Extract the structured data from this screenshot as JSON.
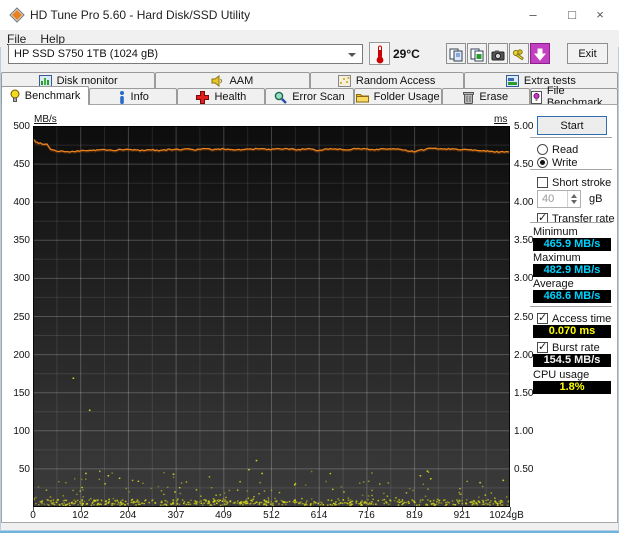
{
  "window": {
    "title": "HD Tune Pro 5.60 - Hard Disk/SSD Utility",
    "menu": [
      "File",
      "Help"
    ],
    "minimize_glyph": "–",
    "maximize_glyph": "□",
    "close_glyph": "×"
  },
  "toolbar": {
    "drive_selected": "HP SSD S750 1TB (1024 gB)",
    "temperature": "29°C",
    "exit_label": "Exit",
    "buttons": [
      "copy-text-icon",
      "copy-image-icon",
      "screenshot-icon",
      "settings-keys-icon",
      "save-results-icon"
    ]
  },
  "tabs_row1": [
    {
      "label": "Disk monitor",
      "icon": "disk-monitor-icon"
    },
    {
      "label": "AAM",
      "icon": "speaker-icon"
    },
    {
      "label": "Random Access",
      "icon": "random-access-icon"
    },
    {
      "label": "Extra tests",
      "icon": "extra-tests-icon"
    }
  ],
  "tabs_row2": [
    {
      "label": "Benchmark",
      "icon": "benchmark-icon",
      "active": true
    },
    {
      "label": "Info",
      "icon": "info-icon",
      "active": false
    },
    {
      "label": "Health",
      "icon": "health-icon",
      "active": false
    },
    {
      "label": "Error Scan",
      "icon": "error-scan-icon",
      "active": false
    },
    {
      "label": "Folder Usage",
      "icon": "folder-icon",
      "active": false
    },
    {
      "label": "Erase",
      "icon": "erase-icon",
      "active": false
    },
    {
      "label": "File Benchmark",
      "icon": "file-benchmark-icon",
      "active": false
    }
  ],
  "panel": {
    "start_label": "Start",
    "read_label": "Read",
    "write_label": "Write",
    "write_selected": true,
    "short_stroke_label": "Short stroke",
    "short_stroke_checked": false,
    "stroke_value": "40",
    "stroke_unit": "gB",
    "transfer_rate_label": "Transfer rate",
    "transfer_rate_checked": true,
    "minimum_label": "Minimum",
    "minimum_value": "465.9 MB/s",
    "maximum_label": "Maximum",
    "maximum_value": "482.9 MB/s",
    "average_label": "Average",
    "average_value": "468.6 MB/s",
    "access_time_label": "Access time",
    "access_time_checked": true,
    "access_time_value": "0.070 ms",
    "burst_rate_label": "Burst rate",
    "burst_rate_checked": true,
    "burst_rate_value": "154.5 MB/s",
    "cpu_label": "CPU usage",
    "cpu_value": "1.8%"
  },
  "chart_data": {
    "type": "line",
    "title": "Write benchmark transfer rate with access time scatter",
    "x_axis": {
      "min": 0,
      "max": 1024,
      "ticks": [
        "0",
        "102",
        "204",
        "307",
        "409",
        "512",
        "614",
        "716",
        "819",
        "921",
        "1024"
      ],
      "last_suffix": "gB",
      "divisions": 20
    },
    "y_left": {
      "label": "MB/s",
      "min": 0,
      "max": 500,
      "ticks": [
        500,
        450,
        400,
        350,
        300,
        250,
        200,
        150,
        100,
        50
      ],
      "minor_step": 25
    },
    "y_right": {
      "label": "ms",
      "min": 0,
      "max": 5,
      "ticks": [
        "5.00",
        "4.50",
        "4.00",
        "3.50",
        "3.00",
        "2.50",
        "2.00",
        "1.50",
        "1.00",
        "0.50"
      ]
    },
    "series": [
      {
        "name": "transfer-rate",
        "unit": "MB/s",
        "color": "#e8821e",
        "x": [
          0,
          6,
          12,
          20,
          30,
          38,
          46,
          55,
          65,
          75,
          85,
          95,
          110,
          130,
          150,
          170,
          190,
          210,
          230,
          250,
          270,
          290,
          310,
          330,
          350,
          370,
          390,
          410,
          430,
          450,
          470,
          490,
          510,
          530,
          550,
          570,
          590,
          610,
          630,
          650,
          670,
          690,
          710,
          730,
          750,
          770,
          790,
          800,
          810,
          820,
          830,
          845,
          860,
          880,
          900,
          920,
          940,
          960,
          980,
          1000,
          1012,
          1024
        ],
        "y": [
          483,
          479,
          478,
          477,
          476,
          470,
          468,
          467,
          467,
          466,
          466,
          467,
          468,
          468,
          469,
          468,
          469,
          469,
          468,
          469,
          468,
          469,
          469,
          470,
          469,
          470,
          469,
          470,
          469,
          469,
          470,
          470,
          469,
          470,
          470,
          469,
          470,
          468,
          470,
          470,
          469,
          470,
          470,
          469,
          470,
          470,
          469,
          468,
          467,
          466,
          468,
          470,
          471,
          470,
          470,
          469,
          469,
          468,
          467,
          466,
          466,
          466
        ]
      }
    ],
    "scatter": {
      "name": "access-time",
      "unit": "ms",
      "color": "#d4d41c",
      "seed": 1337,
      "bottom_band": {
        "count": 480,
        "ms_min": 0.03,
        "ms_max": 0.1
      },
      "spread": {
        "count": 150,
        "ms_min": 0.1,
        "ms_max": 0.48
      },
      "outliers": [
        [
          85,
          1.7
        ],
        [
          120,
          1.28
        ],
        [
          112,
          0.45
        ],
        [
          160,
          0.42
        ],
        [
          300,
          0.44
        ],
        [
          462,
          0.5
        ],
        [
          478,
          0.62
        ],
        [
          490,
          0.45
        ],
        [
          560,
          0.3
        ],
        [
          830,
          0.42
        ],
        [
          845,
          0.48
        ],
        [
          852,
          0.38
        ],
        [
          958,
          0.33
        ],
        [
          1008,
          0.36
        ]
      ]
    },
    "grid": {
      "major_color": "rgba(255,255,255,0.22)",
      "minor_color": "rgba(255,255,255,0.10)",
      "bg_top": "#0d0d0d",
      "bg_bottom": "#3c3c3c"
    }
  }
}
